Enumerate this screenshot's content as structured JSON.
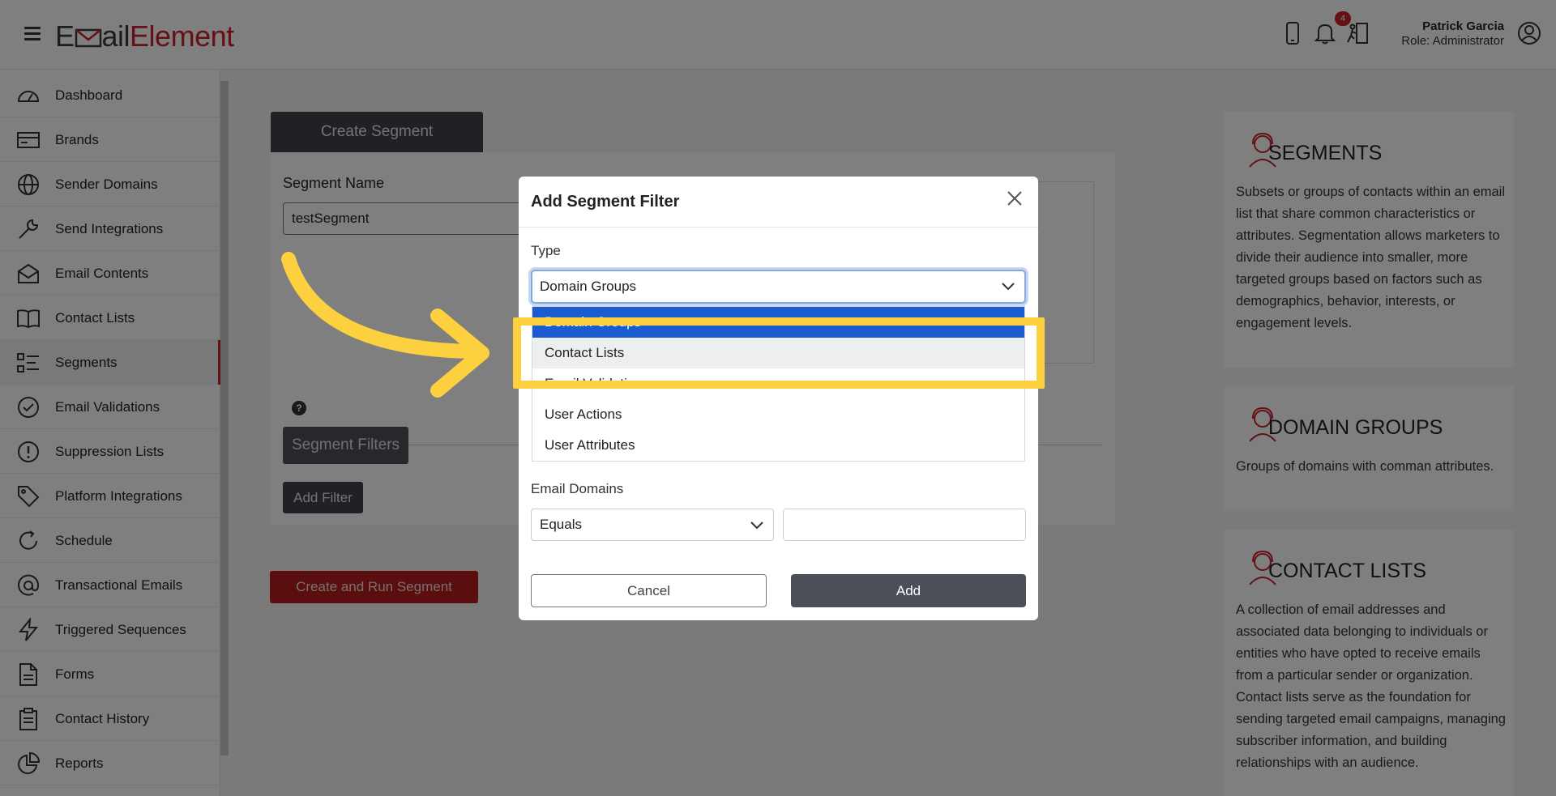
{
  "header": {
    "logo_part1": "E",
    "logo_part2": "ail",
    "logo_part3": "Element",
    "notification_count": "4",
    "user_name": "Patrick Garcia",
    "user_role": "Role: Administrator",
    "icons": [
      "hamburger-icon",
      "mobile-icon",
      "bell-icon",
      "logout-icon",
      "user-circle-icon"
    ]
  },
  "sidebar": {
    "items": [
      {
        "label": "Dashboard",
        "icon": "dashboard-icon"
      },
      {
        "label": "Brands",
        "icon": "brands-icon"
      },
      {
        "label": "Sender Domains",
        "icon": "globe-icon"
      },
      {
        "label": "Send Integrations",
        "icon": "wrench-icon"
      },
      {
        "label": "Email Contents",
        "icon": "envelope-icon"
      },
      {
        "label": "Contact Lists",
        "icon": "book-icon"
      },
      {
        "label": "Segments",
        "icon": "list-icon"
      },
      {
        "label": "Email Validations",
        "icon": "check-circle-icon"
      },
      {
        "label": "Suppression Lists",
        "icon": "exclamation-circle-icon"
      },
      {
        "label": "Platform Integrations",
        "icon": "tag-icon"
      },
      {
        "label": "Schedule",
        "icon": "refresh-icon"
      },
      {
        "label": "Transactional Emails",
        "icon": "at-icon"
      },
      {
        "label": "Triggered Sequences",
        "icon": "lightning-icon"
      },
      {
        "label": "Forms",
        "icon": "document-icon"
      },
      {
        "label": "Contact History",
        "icon": "clipboard-icon"
      },
      {
        "label": "Reports",
        "icon": "pie-chart-icon"
      }
    ],
    "active": "Segments"
  },
  "main": {
    "tab_label": "Create Segment",
    "segment_name_label": "Segment Name",
    "segment_name_value": "testSegment",
    "help_glyph": "?",
    "segment_filters_label": "Segment Filters",
    "add_filter_label": "Add Filter",
    "create_run_label": "Create and Run Segment"
  },
  "info_panel": [
    {
      "title": "SEGMENTS",
      "desc": "Subsets or groups of contacts within an email list that share common characteristics or attributes. Segmentation allows marketers to divide their audience into smaller, more targeted groups based on factors such as demographics, behavior, interests, or engagement levels."
    },
    {
      "title": "DOMAIN GROUPS",
      "desc": "Groups of domains with comman attributes."
    },
    {
      "title": "CONTACT LISTS",
      "desc": "A collection of email addresses and associated data belonging to individuals or entities who have opted to receive emails from a particular sender or organization. Contact lists serve as the foundation for sending targeted email campaigns, managing subscriber information, and building relationships with an audience."
    }
  ],
  "modal": {
    "title": "Add Segment Filter",
    "type_label": "Type",
    "type_selected": "Domain Groups",
    "options": [
      "Domain Groups",
      "Contact Lists",
      "Email Validations",
      "User Actions",
      "User Attributes"
    ],
    "email_domains_label": "Email Domains",
    "operator_selected": "Equals",
    "value_input": "",
    "cancel_label": "Cancel",
    "add_label": "Add"
  },
  "colors": {
    "brand_red": "#c8202a",
    "dark_button": "#3e424a",
    "highlight_yellow": "#fcd03e",
    "select_blue": "#1a5ccf"
  }
}
